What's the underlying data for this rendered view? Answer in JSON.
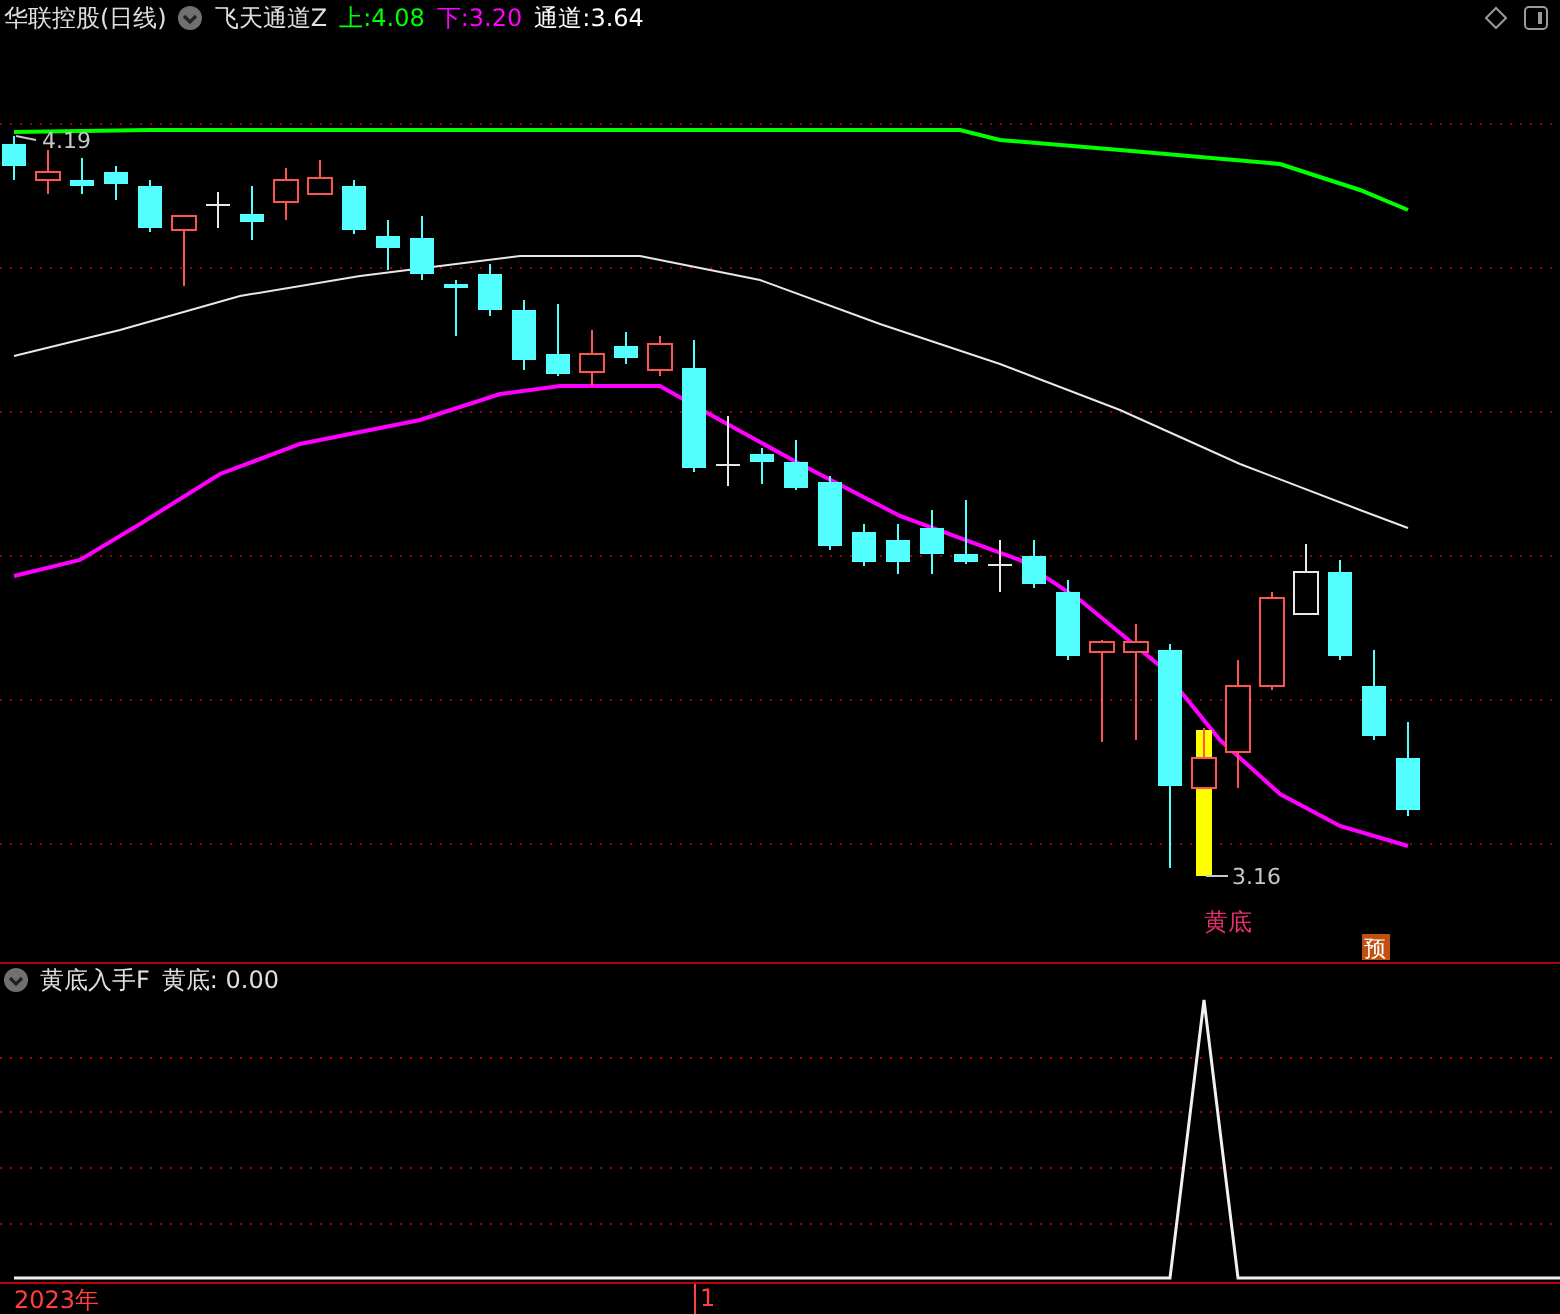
{
  "header": {
    "stock": "华联控股(日线)",
    "indicator": "飞天通道Z",
    "values": [
      {
        "label": "上:",
        "value": "4.08",
        "color": "#00ff00"
      },
      {
        "label": "下:",
        "value": "3.20",
        "color": "#ff00ff"
      },
      {
        "label": "通道:",
        "value": "3.64",
        "color": "#ffffff"
      }
    ]
  },
  "main_chart": {
    "high_label": "4.19",
    "low_label": "3.16",
    "signal_label": "黄底",
    "badge": "预"
  },
  "sub_panel": {
    "indicator": "黄底入手F",
    "values": [
      {
        "label": "黄底:",
        "value": "0.00"
      }
    ]
  },
  "axis": {
    "year": "2023年",
    "month": "1"
  }
}
